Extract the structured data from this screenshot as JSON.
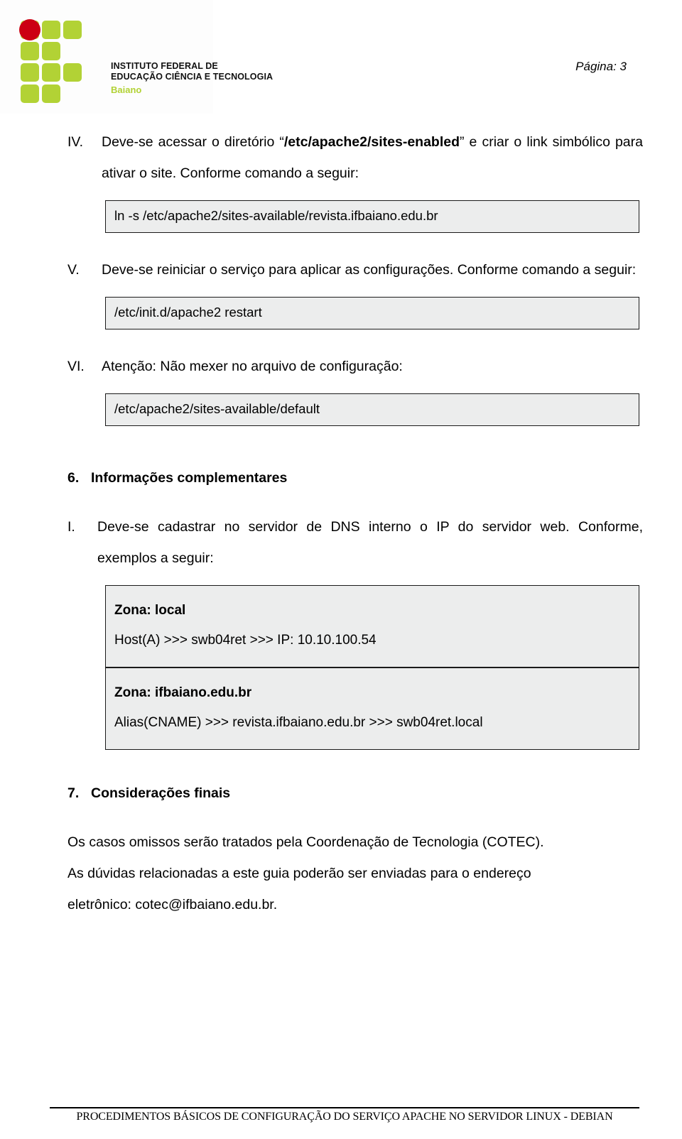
{
  "header": {
    "logo": {
      "icon": "ifbaiano-grid-logo",
      "line1": "INSTITUTO FEDERAL DE",
      "line2": "EDUCAÇÃO CIÊNCIA E TECNOLOGIA",
      "line3": "Baiano",
      "colors": {
        "dot": "#cc0013",
        "squares": "#b2d235",
        "text": "#111111",
        "baiano": "#b2d235"
      }
    },
    "page_label": "Página: 3"
  },
  "items": {
    "iv": {
      "marker": "IV.",
      "text_before": "Deve-se acessar o diretório “",
      "bold_path": "/etc/apache2/sites-enabled",
      "text_after": "” e criar o link simbólico para ativar o site. Conforme comando a seguir:",
      "code": "ln -s /etc/apache2/sites-available/revista.ifbaiano.edu.br"
    },
    "v": {
      "marker": "V.",
      "text": "Deve-se reiniciar o serviço para aplicar as configurações. Conforme comando a seguir:",
      "code": "/etc/init.d/apache2 restart"
    },
    "vi": {
      "marker": "VI.",
      "text": "Atenção: Não mexer no arquivo de configuração:",
      "code": "/etc/apache2/sites-available/default"
    }
  },
  "section6": {
    "number": "6.",
    "title": "Informações complementares",
    "item_i": {
      "marker": "I.",
      "text": "Deve-se cadastrar no servidor de DNS interno o IP do servidor web. Conforme, exemplos a seguir:"
    },
    "zone_local": {
      "title": "Zona: local",
      "record": "Host(A) >>> swb04ret >>> IP: 10.10.100.54"
    },
    "zone_ifbaiano": {
      "title": "Zona: ifbaiano.edu.br",
      "record": "Alias(CNAME) >>> revista.ifbaiano.edu.br >>> swb04ret.local"
    }
  },
  "section7": {
    "number": "7.",
    "title": "Considerações finais",
    "paragraph1": "Os casos omissos serão tratados pela Coordenação de Tecnologia (COTEC).",
    "paragraph2": "As dúvidas relacionadas a este guia poderão ser enviadas para o endereço",
    "paragraph3": "eletrônico: cotec@ifbaiano.edu.br."
  },
  "footer": {
    "text": "PROCEDIMENTOS BÁSICOS DE CONFIGURAÇÃO DO SERVIÇO APACHE NO SERVIDOR LINUX - DEBIAN"
  }
}
